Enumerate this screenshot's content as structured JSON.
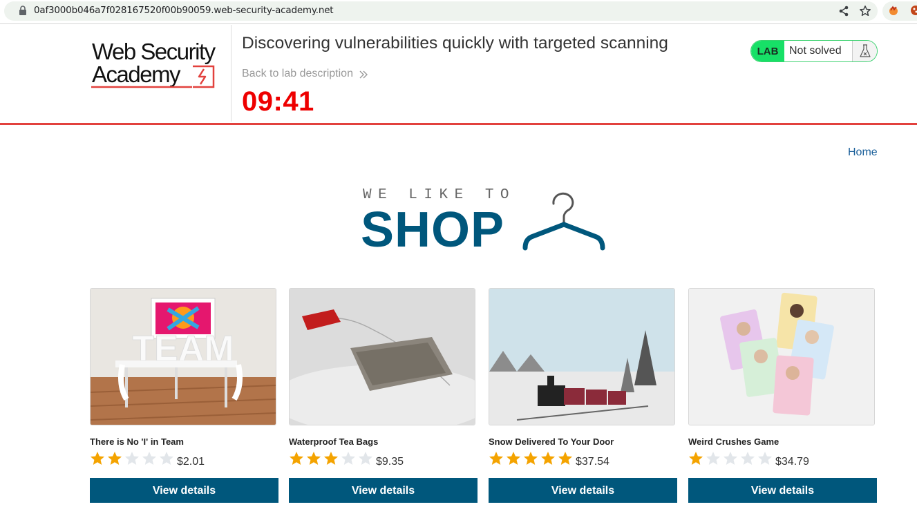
{
  "browser": {
    "url": "0af3000b046a7f028167520f00b90059.web-security-academy.net",
    "icons": [
      "lock-icon",
      "share-icon",
      "star-icon",
      "extension-icon",
      "extension-icon"
    ]
  },
  "lab_header": {
    "logo_text": "Web Security Academy",
    "title": "Discovering vulnerabilities quickly with targeted scanning",
    "back_link": "Back to lab description",
    "timer": "09:41",
    "status_badge": "LAB",
    "status_text": "Not solved",
    "colors": {
      "accent_red": "#e2413d",
      "timer": "#ee0000",
      "status_green": "#17e067"
    }
  },
  "nav": {
    "home": "Home"
  },
  "shop_logo": {
    "tagline": "WE LIKE TO",
    "word": "SHOP",
    "color": "#00577c"
  },
  "products": [
    {
      "name": "There is No 'I' in Team",
      "rating": 2,
      "price": "$2.01",
      "button": "View details",
      "image_text": "TEAM"
    },
    {
      "name": "Waterproof Tea Bags",
      "rating": 3,
      "price": "$9.35",
      "button": "View details"
    },
    {
      "name": "Snow Delivered To Your Door",
      "rating": 5,
      "price": "$37.54",
      "button": "View details"
    },
    {
      "name": "Weird Crushes Game",
      "rating": 1,
      "price": "$34.79",
      "button": "View details"
    }
  ]
}
